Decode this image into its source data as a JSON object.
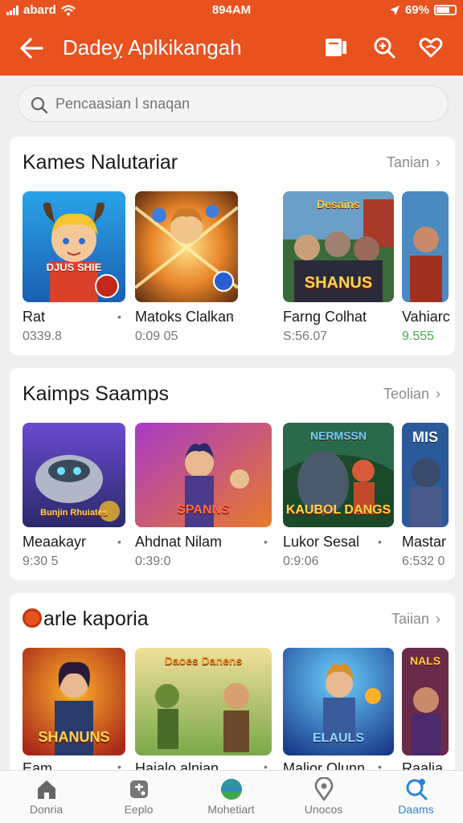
{
  "status_bar": {
    "carrier": "abard",
    "time": "894AM",
    "battery": "69%"
  },
  "app_bar": {
    "title": "Dadeỵ Aplkikangah",
    "back_icon": "arrow-left-icon",
    "actions": [
      "tablet-icon",
      "search-plus-icon",
      "heart-icon"
    ]
  },
  "search": {
    "placeholder": "Pencaasian l snaqan",
    "value": ""
  },
  "colors": {
    "accent": "#e8521f",
    "active_nav": "#2b85d6",
    "meta_green": "#4caf50"
  },
  "sections": [
    {
      "title": "Kames Nalutariar",
      "more": "Tanian",
      "items": [
        {
          "name": "Rat",
          "meta": "0339.8"
        },
        {
          "name": "Matoks Clalkan",
          "meta": "0:09 05"
        },
        {
          "name": "Farng Colhat",
          "meta": "S:56.07",
          "thumb_text": "SHANUS",
          "thumb_top": "Desains"
        },
        {
          "name": "Vahiarc",
          "meta": "9.555"
        }
      ],
      "first_thumb_text": "DJUS SHIE"
    },
    {
      "title": "Kaimps  Saamps",
      "more": "Teolian",
      "items": [
        {
          "name": "Meaakayr",
          "meta": "9:30 5",
          "thumb_text": "Bunjin Rhuiates"
        },
        {
          "name": "Ahdnat  Nilam",
          "meta": "0:39:0",
          "thumb_text": "SPANNS"
        },
        {
          "name": "Lukor Sesal",
          "meta": "0:9:06",
          "thumb_text": "KAUBOL DANGS",
          "thumb_top": "NERMSSN"
        },
        {
          "name": "Mastar",
          "meta": "6:532 0",
          "thumb_top": "MIS"
        }
      ]
    },
    {
      "title": "arle kaporia",
      "more": "Taiian",
      "items": [
        {
          "name": "Eam",
          "thumb_text": "SHANUNS"
        },
        {
          "name": "Haialo alnian",
          "thumb_top": "Daoes Danens"
        },
        {
          "name": "Malior Qlunn",
          "thumb_text": "ELAULS"
        },
        {
          "name": "Raalia",
          "thumb_top": "NALS"
        }
      ]
    }
  ],
  "bottom_nav": [
    {
      "label": "Donria",
      "icon": "home-icon"
    },
    {
      "label": "Eeplo",
      "icon": "gamepad-icon"
    },
    {
      "label": "Mohetiart",
      "icon": "globe-icon"
    },
    {
      "label": "Unocos",
      "icon": "location-pin-icon"
    },
    {
      "label": "Daams",
      "icon": "search-user-icon",
      "active": true
    }
  ]
}
